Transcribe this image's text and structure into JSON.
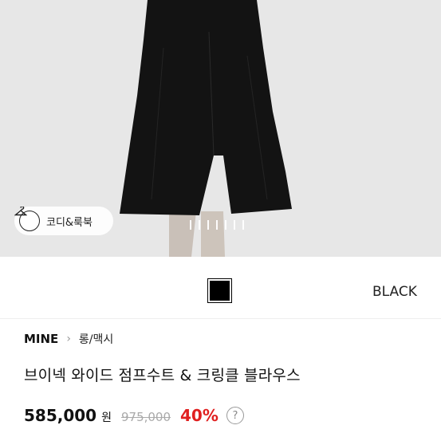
{
  "hero": {
    "coord_button_label": "코디&룩북",
    "carousel_pages": 7
  },
  "variant": {
    "color_name": "BLACK",
    "swatch_color": "#000000"
  },
  "product": {
    "brand": "MINE",
    "category": "롱/맥시",
    "title": "브이넥 와이드 점프수트 & 크링클 블라우스",
    "price": "585,000",
    "currency": "원",
    "original_price": "975,000",
    "discount": "40%",
    "help_icon_glyph": "?"
  },
  "colors": {
    "discount": "#e02020",
    "original_price": "#aaaaaa"
  }
}
